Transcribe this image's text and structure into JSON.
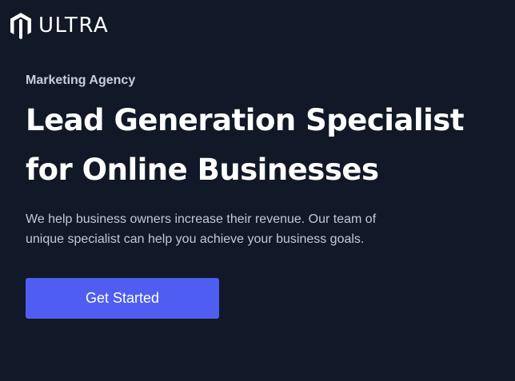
{
  "brand": {
    "name": "ULTRA",
    "icon": "magento-logo-icon",
    "text_color": "#ffffff"
  },
  "hero": {
    "eyebrow": "Marketing Agency",
    "headline_line_1": "Lead Generation Specialist",
    "headline_line_2": "for Online Businesses",
    "description": "We help business owners increase their revenue. Our team of unique specialist can help you achieve your business goals."
  },
  "cta": {
    "label": "Get Started",
    "color": "#4f5ef1"
  },
  "colors": {
    "background": "#111827",
    "heading": "#ffffff",
    "body_text": "#c2c8d4"
  }
}
